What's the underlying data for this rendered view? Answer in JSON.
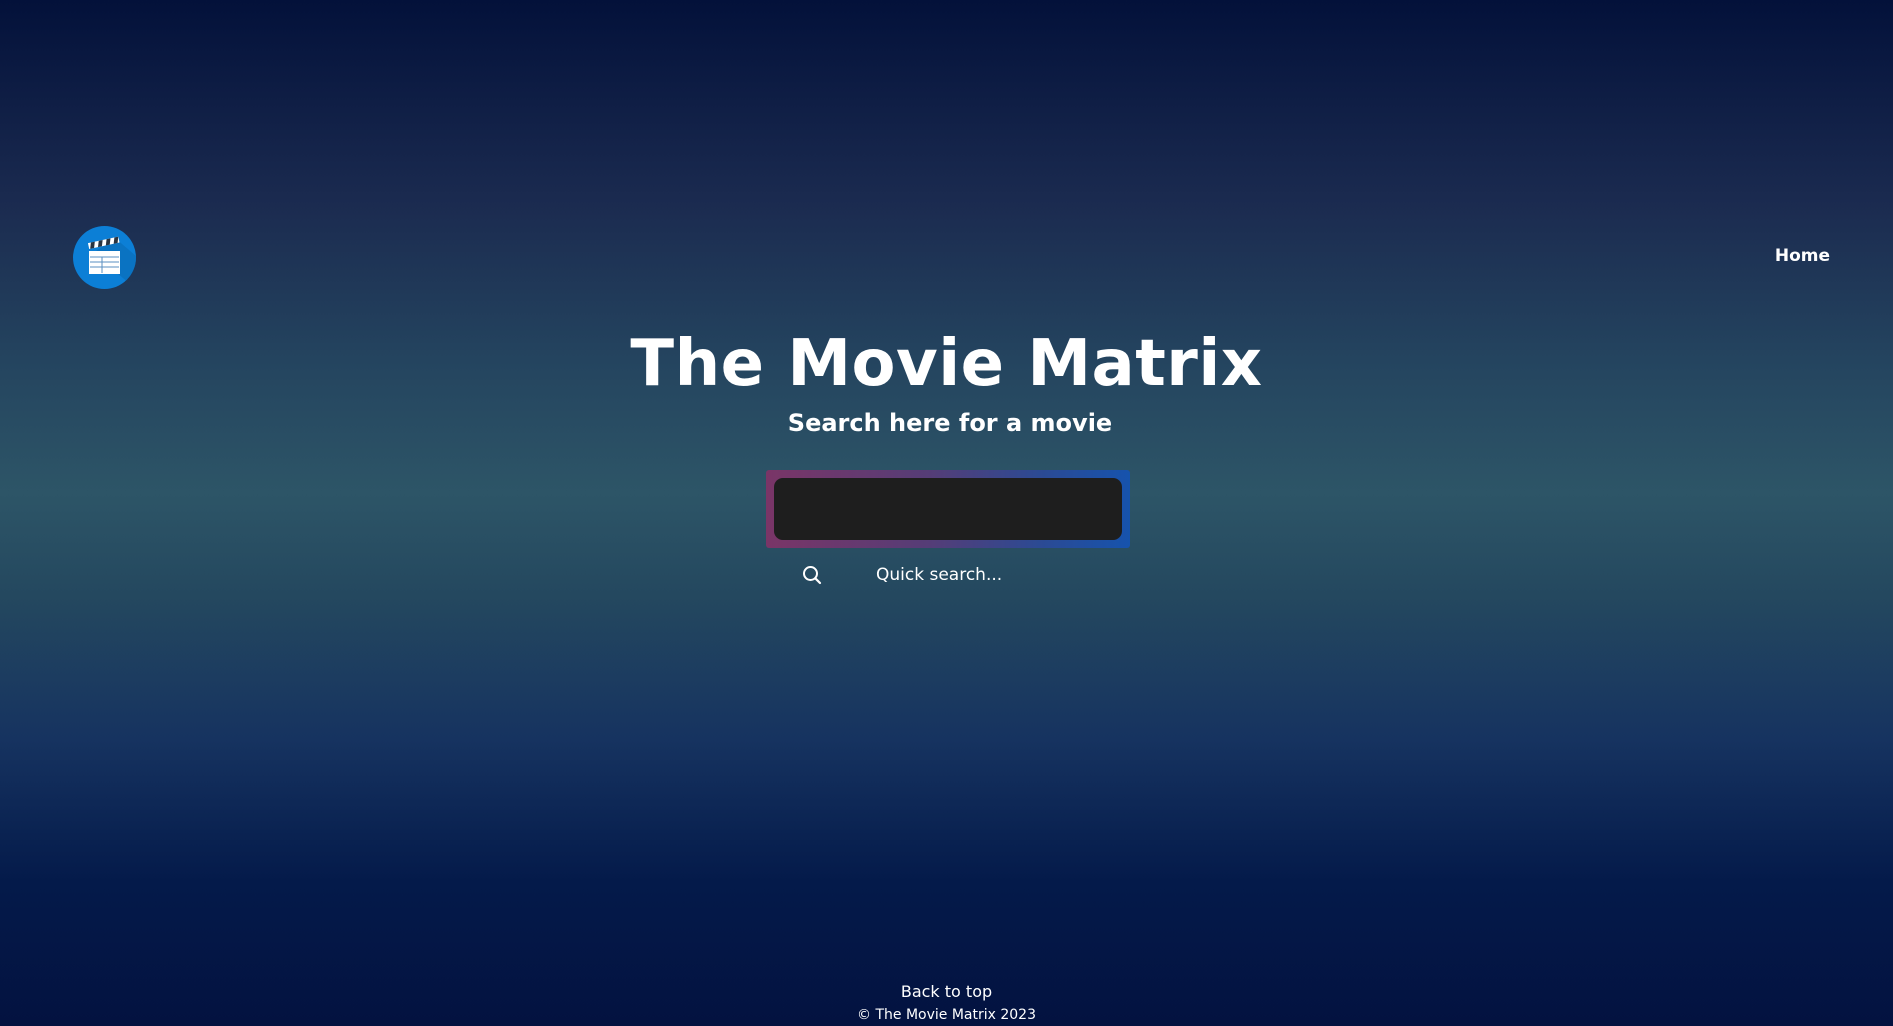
{
  "header": {
    "logo_icon": "clapperboard-icon",
    "logo_color": "#0c7fd6",
    "nav_home": "Home"
  },
  "hero": {
    "title": "The Movie Matrix",
    "subtitle": "Search here for a movie"
  },
  "search": {
    "value": "",
    "placeholder": "",
    "quick_search_label": "Quick search...",
    "quick_search_icon": "search-icon",
    "frame_gradient": [
      "#7a3567",
      "#1653ad"
    ],
    "input_background": "#1e1e1e"
  },
  "footer": {
    "back_to_top": "Back to top",
    "copyright": "© The Movie Matrix 2023"
  }
}
